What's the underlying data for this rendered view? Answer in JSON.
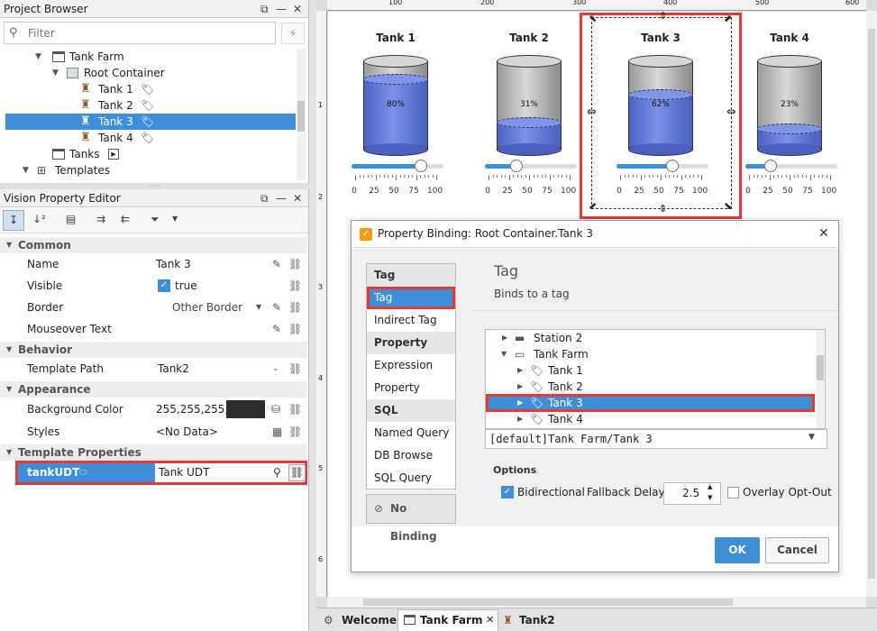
{
  "project_browser": {
    "title": "Project Browser",
    "filter_placeholder": "Filter",
    "tree": [
      {
        "label": "Tank Farm"
      },
      {
        "label": "Root Container"
      },
      {
        "label": "Tank 1"
      },
      {
        "label": "Tank 2"
      },
      {
        "label": "Tank 3"
      },
      {
        "label": "Tank 4"
      },
      {
        "label": "Tanks"
      },
      {
        "label": "Templates"
      }
    ]
  },
  "property_editor": {
    "title": "Vision Property Editor",
    "sections": {
      "common": "Common",
      "behavior": "Behavior",
      "appearance": "Appearance",
      "template_properties": "Template Properties"
    },
    "rows": {
      "name_label": "Name",
      "name_value": "Tank 3",
      "visible_label": "Visible",
      "visible_value": "true",
      "border_label": "Border",
      "border_value": "Other Border",
      "mouseover_label": "Mouseover Text",
      "mouseover_value": "",
      "template_path_label": "Template Path",
      "template_path_value": "Tank2",
      "bg_label": "Background Color",
      "bg_value": "255,255,255,",
      "styles_label": "Styles",
      "styles_value": "<No Data>",
      "tankudt_label": "tankUDT",
      "tankudt_value": "Tank UDT"
    }
  },
  "canvas": {
    "ruler_top": [
      "100",
      "200",
      "300",
      "400",
      "500",
      "600"
    ],
    "ruler_left": [
      "1",
      "2",
      "3",
      "4",
      "5",
      "6"
    ],
    "slider_ticks": [
      "0",
      "25",
      "50",
      "75",
      "100"
    ],
    "tanks": [
      {
        "title": "Tank 1",
        "level_text": "80%",
        "level": 0.8,
        "slider": 0.75
      },
      {
        "title": "Tank 2",
        "level_text": "31%",
        "level": 0.31,
        "slider": 0.33
      },
      {
        "title": "Tank 3",
        "level_text": "62%",
        "level": 0.62,
        "slider": 0.6
      },
      {
        "title": "Tank 4",
        "level_text": "23%",
        "level": 0.23,
        "slider": 0.25
      }
    ]
  },
  "dialog": {
    "title": "Property Binding: Root Container.Tank 3",
    "list": {
      "tag_header": "Tag",
      "tag": "Tag",
      "indirect_tag": "Indirect Tag",
      "property_header": "Property",
      "expression": "Expression",
      "property": "Property",
      "sql_header": "SQL",
      "named_query": "Named Query",
      "db_browse": "DB Browse",
      "sql_query": "SQL Query",
      "no_binding": "No Binding"
    },
    "content_title": "Tag",
    "content_subtitle": "Binds to a tag",
    "tag_tree": [
      {
        "label": "Station 2"
      },
      {
        "label": "Tank Farm"
      },
      {
        "label": "Tank 1"
      },
      {
        "label": "Tank 2"
      },
      {
        "label": "Tank 3"
      },
      {
        "label": "Tank 4"
      }
    ],
    "tag_path": "[default]Tank Farm/Tank 3",
    "options_label": "Options",
    "bidirectional_label": "Bidirectional",
    "fallback_label": "Fallback Delay",
    "fallback_value": "2.5",
    "overlay_label": "Overlay Opt-Out",
    "ok_label": "OK",
    "cancel_label": "Cancel"
  },
  "bottom_tabs": [
    {
      "label": "Welcome"
    },
    {
      "label": "Tank Farm"
    },
    {
      "label": "Tank2"
    }
  ],
  "colors": {
    "selection": "#3e8fd8",
    "highlight_box": "#e53935",
    "fluid": "#5a74d6",
    "ok_button": "#3e8fd8"
  }
}
